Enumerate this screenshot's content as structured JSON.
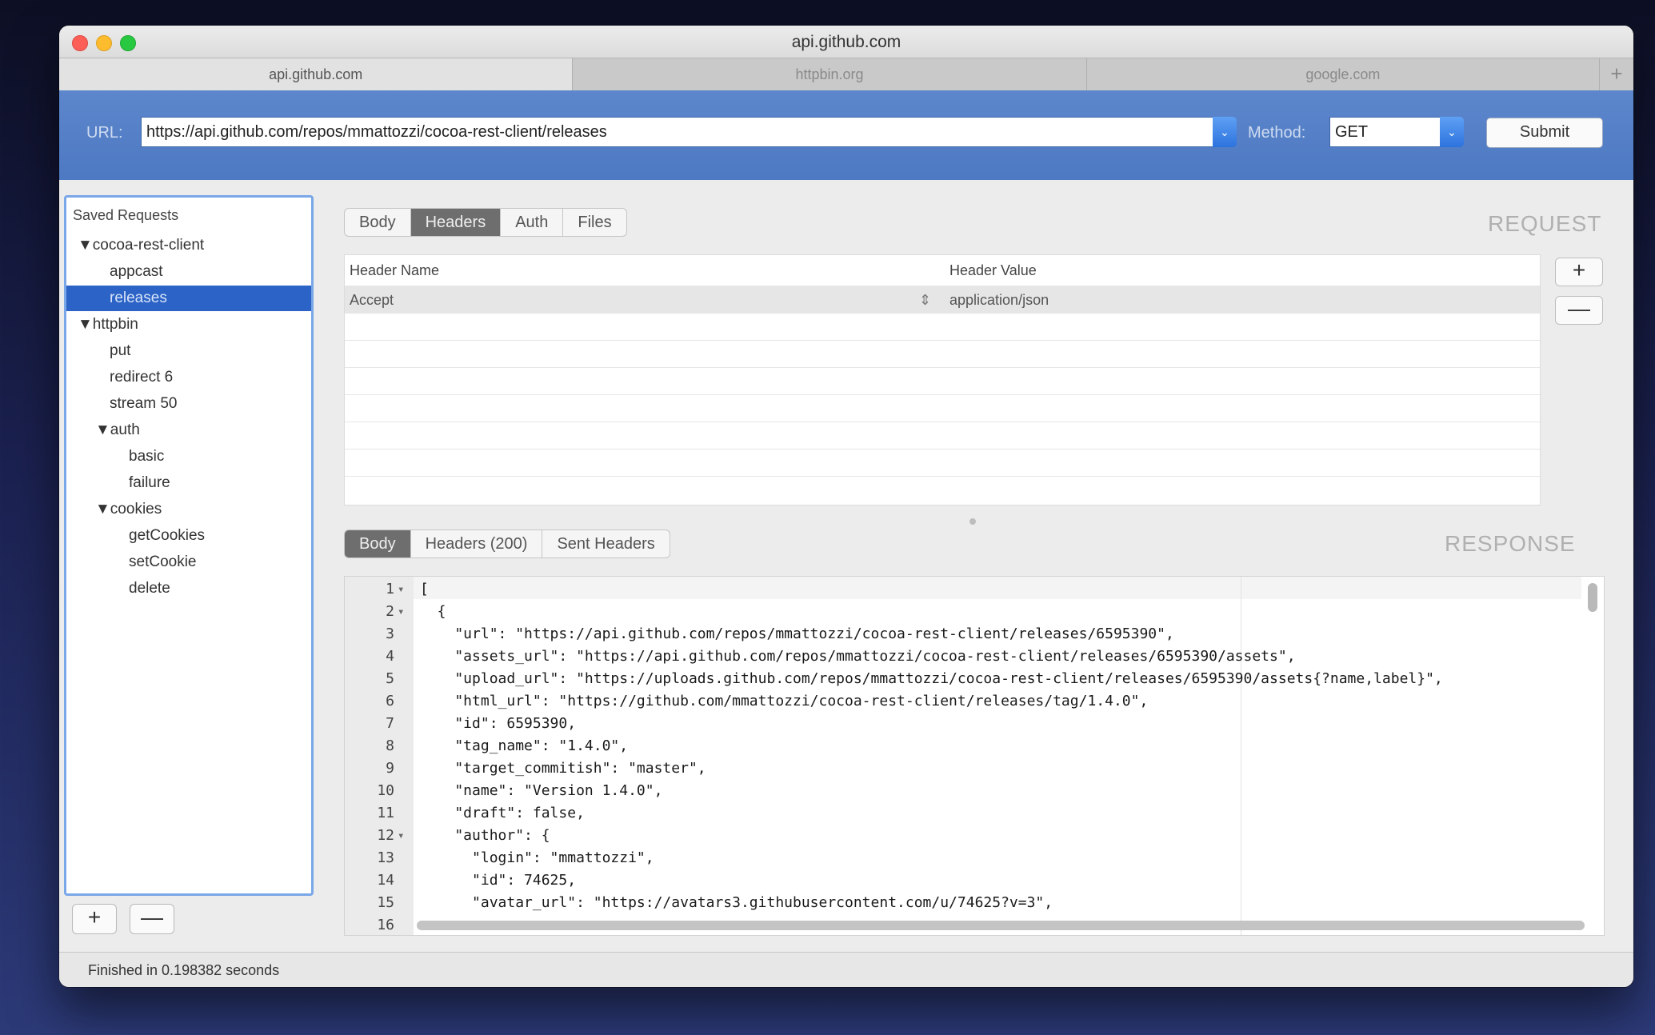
{
  "window": {
    "title": "api.github.com"
  },
  "tabs": [
    {
      "label": "api.github.com",
      "active": true
    },
    {
      "label": "httpbin.org",
      "active": false
    },
    {
      "label": "google.com",
      "active": false
    }
  ],
  "tab_add_label": "+",
  "url_bar": {
    "url_label": "URL:",
    "url_value": "https://api.github.com/repos/mmattozzi/cocoa-rest-client/releases",
    "method_label": "Method:",
    "method_value": "GET",
    "submit_label": "Submit"
  },
  "sidebar": {
    "title": "Saved Requests",
    "items": [
      {
        "label": "▼cocoa-rest-client",
        "indent": 1
      },
      {
        "label": "appcast",
        "indent": 3
      },
      {
        "label": "releases",
        "indent": 3,
        "selected": true
      },
      {
        "label": "▼httpbin",
        "indent": 1
      },
      {
        "label": "put",
        "indent": 3
      },
      {
        "label": "redirect 6",
        "indent": 3
      },
      {
        "label": "stream 50",
        "indent": 3
      },
      {
        "label": "▼auth",
        "indent": 2
      },
      {
        "label": "basic",
        "indent": 4
      },
      {
        "label": "failure",
        "indent": 4
      },
      {
        "label": "▼cookies",
        "indent": 2
      },
      {
        "label": "getCookies",
        "indent": 4
      },
      {
        "label": "setCookie",
        "indent": 4
      },
      {
        "label": "delete",
        "indent": 4
      }
    ],
    "add_label": "+",
    "remove_label": "—"
  },
  "request": {
    "section_label": "REQUEST",
    "tabs": [
      "Body",
      "Headers",
      "Auth",
      "Files"
    ],
    "active_tab": "Headers",
    "header_name_col": "Header Name",
    "header_value_col": "Header Value",
    "rows": [
      {
        "name": "Accept",
        "value": "application/json"
      }
    ],
    "add_label": "+",
    "remove_label": "—"
  },
  "response": {
    "section_label": "RESPONSE",
    "tabs": [
      "Body",
      "Headers (200)",
      "Sent Headers"
    ],
    "active_tab": "Body",
    "lines": [
      {
        "n": "1",
        "fold": true,
        "text": "["
      },
      {
        "n": "2",
        "fold": true,
        "text": "  {"
      },
      {
        "n": "3",
        "text": "    \"url\": \"https://api.github.com/repos/mmattozzi/cocoa-rest-client/releases/6595390\","
      },
      {
        "n": "4",
        "text": "    \"assets_url\": \"https://api.github.com/repos/mmattozzi/cocoa-rest-client/releases/6595390/assets\","
      },
      {
        "n": "5",
        "text": "    \"upload_url\": \"https://uploads.github.com/repos/mmattozzi/cocoa-rest-client/releases/6595390/assets{?name,label}\","
      },
      {
        "n": "6",
        "text": "    \"html_url\": \"https://github.com/mmattozzi/cocoa-rest-client/releases/tag/1.4.0\","
      },
      {
        "n": "7",
        "text": "    \"id\": 6595390,"
      },
      {
        "n": "8",
        "text": "    \"tag_name\": \"1.4.0\","
      },
      {
        "n": "9",
        "text": "    \"target_commitish\": \"master\","
      },
      {
        "n": "10",
        "text": "    \"name\": \"Version 1.4.0\","
      },
      {
        "n": "11",
        "text": "    \"draft\": false,"
      },
      {
        "n": "12",
        "fold": true,
        "text": "    \"author\": {"
      },
      {
        "n": "13",
        "text": "      \"login\": \"mmattozzi\","
      },
      {
        "n": "14",
        "text": "      \"id\": 74625,"
      },
      {
        "n": "15",
        "text": "      \"avatar_url\": \"https://avatars3.githubusercontent.com/u/74625?v=3\","
      },
      {
        "n": "16",
        "text": ""
      }
    ]
  },
  "status": {
    "text": "Finished in 0.198382 seconds"
  }
}
